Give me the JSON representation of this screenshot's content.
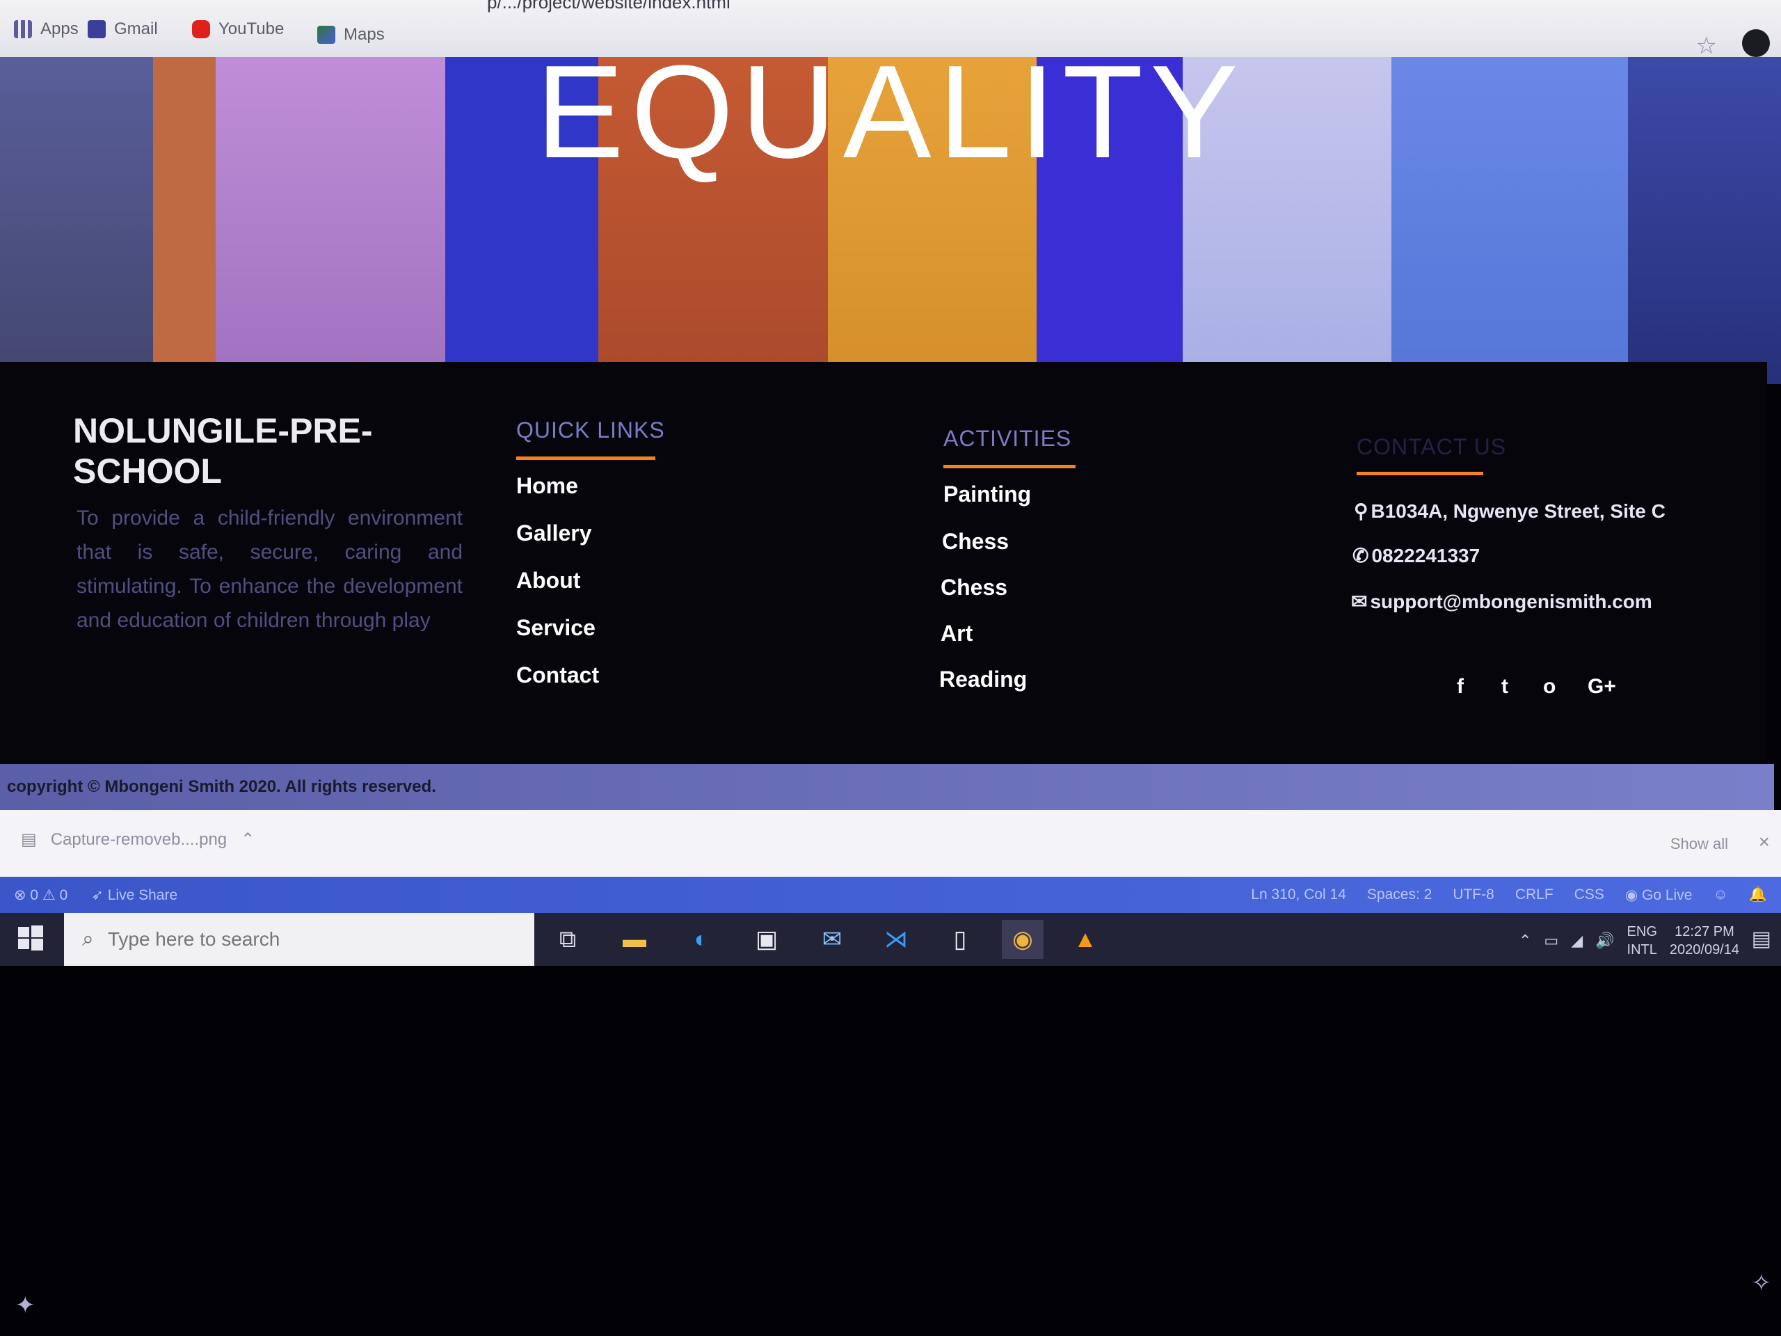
{
  "browser": {
    "url_fragment": "p/.../project/website/index.html",
    "bookmarks": [
      {
        "label": "Apps",
        "icon": "apps-grid-icon",
        "color": "#5b5ba0"
      },
      {
        "label": "Gmail",
        "icon": "gmail-icon",
        "color": "#c9302c"
      },
      {
        "label": "YouTube",
        "icon": "youtube-icon",
        "color": "#e0201b"
      },
      {
        "label": "Maps",
        "icon": "maps-icon",
        "color": "#2b7a3b"
      }
    ]
  },
  "hero": {
    "title": "EQUALITY"
  },
  "footer": {
    "brand": {
      "title": "NOLUNGILE-PRE-SCHOOL",
      "description": "To provide a child-friendly environment that is safe, secure, caring and stimulating. To enhance the development and education of children through play"
    },
    "quick_links": {
      "heading": "QUICK LINKS",
      "items": [
        "Home",
        "Gallery",
        "About",
        "Service",
        "Contact"
      ]
    },
    "activities": {
      "heading": "ACTIVITIES",
      "items": [
        "Painting",
        "Chess",
        "Chess",
        "Art",
        "Reading"
      ]
    },
    "contact": {
      "heading": "CONTACT US",
      "address": "B1034A, Ngwenye Street, Site C",
      "phone": "0822241337",
      "email": "support@mbongenismith.com"
    },
    "social": [
      "f",
      "t",
      "o",
      "G+"
    ],
    "accent_color": "#f58220"
  },
  "copyright": "copyright © Mbongeni Smith 2020. All rights reserved.",
  "downloads": {
    "file": "Capture-removeb....png",
    "show_all": "Show all",
    "close": "×"
  },
  "vscode_status": {
    "problems": "⊗ 0 ⚠ 0",
    "live_share": "Live Share",
    "position": "Ln 310, Col 14",
    "spaces": "Spaces: 2",
    "encoding": "UTF-8",
    "eol": "CRLF",
    "language": "CSS",
    "go_live": "Go Live"
  },
  "taskbar": {
    "search_placeholder": "Type here to search",
    "lang_top": "ENG",
    "lang_bottom": "INTL",
    "time": "12:27 PM",
    "date": "2020/09/14"
  }
}
